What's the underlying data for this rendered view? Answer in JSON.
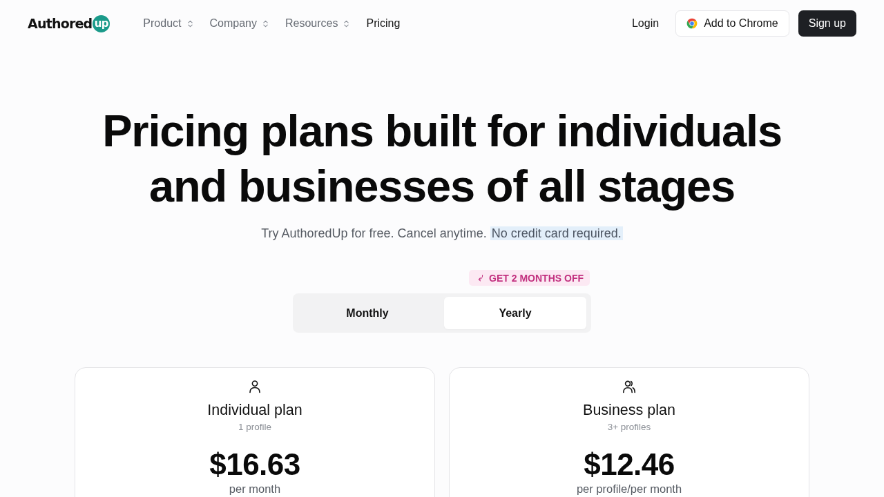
{
  "header": {
    "logo": {
      "text": "Authored",
      "badge": "up"
    },
    "nav": [
      {
        "label": "Product",
        "has_menu": true,
        "selected": false
      },
      {
        "label": "Company",
        "has_menu": true,
        "selected": false
      },
      {
        "label": "Resources",
        "has_menu": true,
        "selected": false
      },
      {
        "label": "Pricing",
        "has_menu": false,
        "selected": true
      }
    ],
    "actions": [
      {
        "label": "Login",
        "kind": "link"
      },
      {
        "label": "Add to Chrome",
        "kind": "chrome"
      },
      {
        "label": "Sign up",
        "kind": "primary"
      }
    ]
  },
  "hero": {
    "title_lines": [
      "Pricing plans built for individuals",
      "and businesses of all stages"
    ],
    "subtitle": {
      "text": "Try AuthoredUp for free. Cancel anytime.",
      "highlight": "No credit card required."
    }
  },
  "billing": {
    "promo": "GET 2 MONTHS OFF",
    "options": [
      {
        "label": "Monthly",
        "selected": false
      },
      {
        "label": "Yearly",
        "selected": true
      }
    ]
  },
  "plans": [
    {
      "kind": "single",
      "name": "Individual plan",
      "seats": "1 profile",
      "price": "$16.63",
      "period": "per month"
    },
    {
      "kind": "team",
      "name": "Business plan",
      "seats": "3+ profiles",
      "price": "$12.46",
      "period": "per profile/per month"
    }
  ]
}
